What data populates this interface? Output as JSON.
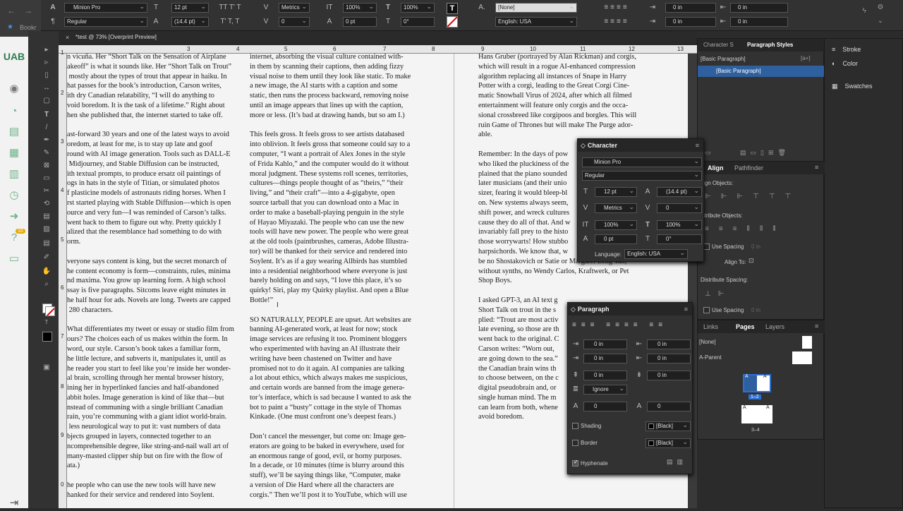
{
  "browser": {
    "bookmark": "Bookr"
  },
  "control_bar": {
    "font_family": "Minion Pro",
    "font_style": "Regular",
    "font_size": "12 pt",
    "leading": "(14.4 pt)",
    "kerning": "Metrics",
    "tracking": "0",
    "vscale": "100%",
    "hscale": "100%",
    "baseline": "0 pt",
    "skew": "0°",
    "char_style": "[None]",
    "language": "English: USA",
    "indent_left": "0 in",
    "indent_right": "0 in",
    "indent_first": "0 in",
    "indent_last": "0 in"
  },
  "doc_tab": {
    "title": "*test @ 73% [Overprint Preview]"
  },
  "ruler": [
    "3",
    "4",
    "5",
    "6",
    "7",
    "8",
    "9",
    "10",
    "11",
    "12",
    "13"
  ],
  "vruler": [
    "1",
    "2",
    "3",
    "4",
    "5",
    "6",
    "7",
    "8",
    "9",
    "0"
  ],
  "columns": {
    "left": "n vicuña. Her “Short Talk on the Sensation of Airplane\nakeoff” is what it sounds like. Her “Short Talk on Trout”\n mostly about the types of trout that appear in haiku. In\nhat passes for the book’s introduction, Carson writes,\nith dry Canadian relatability, “I will do anything to\nvoid boredom. It is the task of a lifetime.” Right about\nhen she published that, the internet started to take off.\n\nast-forward 30 years and one of the latest ways to avoid\noredom, at least for me, is to stay up late and goof\nround with AI image generation. Tools such as DALL-E\n Midjourney, and Stable Diffusion can be instructed,\nith textual prompts, to produce ersatz oil paintings of\nogs in hats in the style of Titian, or simulated photos\nf plasticine models of astronauts riding horses. When I\nrst started playing with Stable Diffusion—which is open\nource and very fun—I was reminded of Carson’s talks.\nwent back to them to figure out why. Pretty quickly I\nalized that the resemblance had something to do with\norm.\n\nveryone says content is king, but the secret monarch of\nhe content economy is form—constraints, rules, minima\nnd maxima. You grow up learning form. A high school\nssay is five paragraphs. Sitcoms leave eight minutes in\nhe half hour for ads. Novels are long. Tweets are capped\n 280 characters.\n\nWhat differentiates my tweet or essay or studio film from\nours? The choices each of us makes within the form. In\nword, our style. Carson’s book takes a familiar form,\nhe little lecture, and subverts it, manipulates it, until as\nhe reader you start to feel like you’re inside her wonder-\nal brain, scrolling through her mental browser history,\nining her in hyperlinked fancies and half-abandoned\nabbit holes. Image generation is kind of like that—but\nnstead of communing with a single brilliant Canadian\nrain, you’re communing with a giant idiot world-brain.\n less neurological way to put it: vast numbers of data\nbjects grouped in layers, connected together to an\nncomprehensible degree, like string-and-nail wall art of\nmany-masted clipper ship but on fire with the flow of\nata.)\n\nhe people who can use the new tools will have new\nhanked for their service and rendered into Soylent.",
    "middle": "internet, absorbing the visual culture contained with-\nin them by scanning their captions, then adding fizzy\nvisual noise to them until they look like static. To make\na new image, the AI starts with a caption and some\nstatic, then runs the process backward, removing noise\nuntil an image appears that lines up with the caption,\nmore or less. (It’s bad at drawing hands, but so am I.)\n\nThis feels gross. It feels gross to see artists databased\ninto oblivion. It feels gross that someone could say to a\ncomputer, “I want a portrait of Alex Jones in the style\nof Frida Kahlo,” and the computer would do it without\nmoral judgment. These systems roll scenes, territories,\ncultures—things people thought of as “theirs,” “their\nliving,” and “their craft”—into a 4-gigabyte, open\nsource tarball that you can download onto a Mac in\norder to make a baseball-playing penguin in the style\nof Hayao Miyazaki. The people who can use the new\ntools will have new power. The people who were great\nat the old tools (paintbrushes, cameras, Adobe Illustra-\ntor) will be thanked for their service and rendered into\nSoylent. It’s as if a guy wearing Allbirds has stumbled\ninto a residential neighborhood where everyone is just\nbarely holding on and says, “I love this place, it’s so\nquirky! Siri, play my Quirky playlist. And open a Blue\nBottle!”\n\nSO NATURALLY, PEOPLE are upset. Art websites are\nbanning AI-generated work, at least for now; stock\nimage services are refusing it too. Prominent bloggers\nwho experimented with having an AI illustrate their\nwriting have been chastened on Twitter and have\npromised not to do it again. AI companies are talking\na lot about ethics, which always makes me suspicious,\nand certain words are banned from the image genera-\ntor’s interface, which is sad because I wanted to ask the\nbot to paint a “busty” cottage in the style of Thomas\nKinkade. (One must confront one’s deepest fears.)\n\nDon’t cancel the messenger, but come on: Image gen-\nerators are going to be baked in everywhere, used for\nan enormous range of good, evil, or horny purposes.\nIn a decade, or 10 minutes (time is blurry around this\nstuff), we’ll be saying things like, “Computer, make\na version of Die Hard where all the characters are\ncorgis.” Then we’ll post it to YouTube, which will use",
    "right": "Hans Gruber (portrayed by Alan Rickman) and corgis,\nwhich will result in a rogue AI-enhanced compression\nalgorithm replacing all instances of Snape in Harry\nPotter with a corgi, leading to the Great Corgi Cine-\nmatic Snowball Virus of 2024, after which all filmed\nentertainment will feature only corgis and the occa-\nsional crossbreed like corgipoos and borgles. This will\nruin Game of Thrones but will make The Purge ador-\nable.\n\nRemember: In the days of pow\nwho liked the pluckiness of the\nplained that the piano sounded\nlater musicians (and their unio\nsizer, fearing it would bleep-bl\non. New systems always seem,\nshift power, and wreck cultures\ncause they do all of that. And w\ninvariably fall prey to the histo\nthose worrywarts! How stubbo\nharpsichords. We know that, w\nbe no Shostakovich or Satie or Margaret Leng Tan;\nwithout synths, no Wendy Carlos, Kraftwerk, or Pet\nShop Boys.\n\nI asked GPT-3, an AI text g\nShort Talk on trout in the s\nplied: “Trout are most activ\nlate evening, so those are th\nwent back to the original. C\nCarson writes: “Worn out,\nare going down to the sea.”\nthe Canadian brain wins th\nto choose between, on the c\ndigital pseudobrain and, or\nsingle human mind. The m\ncan learn from both, whene\navoid boredom."
  },
  "panels": {
    "styles": {
      "tab1": "Character S",
      "tab2": "Paragraph Styles",
      "base": "[Basic Paragraph]",
      "selected": "[Basic Paragraph]"
    },
    "right_dock": [
      "Stroke",
      "Color",
      "Swatches"
    ],
    "character": {
      "title": "Character",
      "font": "Minion Pro",
      "style": "Regular",
      "size": "12 pt",
      "leading": "(14.4 pt)",
      "kerning": "Metrics",
      "tracking": "0",
      "vscale": "100%",
      "hscale": "100%",
      "baseline": "0 pt",
      "skew": "0°",
      "lang_label": "Language:",
      "language": "English: USA"
    },
    "align": {
      "tab1": "Align",
      "tab2": "Pathfinder",
      "align_objects": "ign Objects:",
      "distribute_objects": "istribute Objects:",
      "use_spacing": "Use Spacing",
      "spacing_val": "0 in",
      "align_to": "Align To:",
      "distribute_spacing": "Distribute Spacing:",
      "use_spacing2": "Use Spacing",
      "spacing_val2": "0 in"
    },
    "paragraph": {
      "title": "Paragraph",
      "left_indent": "0 in",
      "right_indent": "0 in",
      "first_indent": "0 in",
      "last_indent": "0 in",
      "space_before": "0 in",
      "space_after": "0 in",
      "grid": "Ignore",
      "drop_lines": "0",
      "drop_chars": "0",
      "shading": "Shading",
      "border": "Border",
      "black": "[Black]",
      "hyphenate": "Hyphenate"
    },
    "pages": {
      "tab1": "Links",
      "tab2": "Pages",
      "tab3": "Layers",
      "none": "[None]",
      "parent": "A-Parent",
      "spread1": "1–2",
      "spread2": "3–4",
      "a": "A"
    }
  },
  "app_bar": {
    "badge": "10"
  }
}
